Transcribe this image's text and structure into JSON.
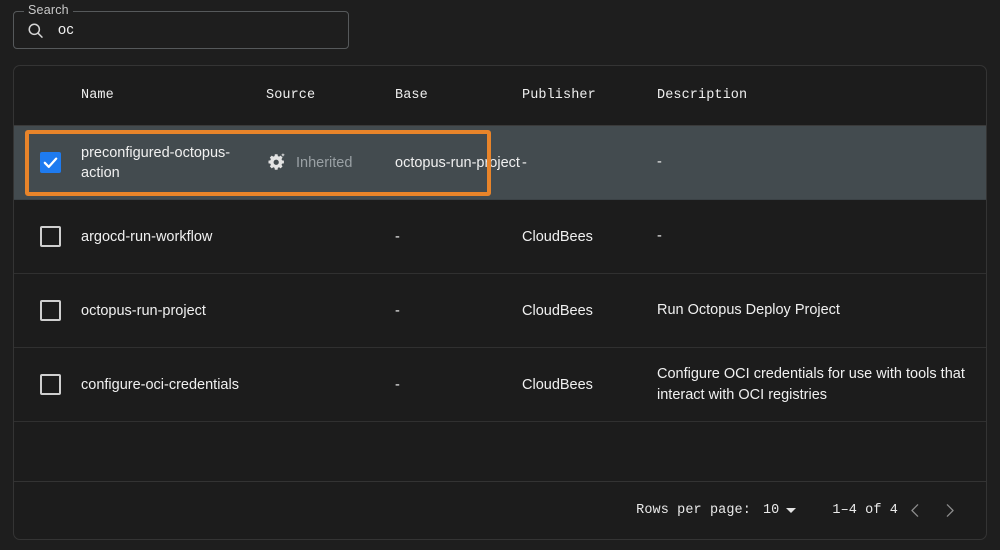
{
  "search": {
    "label": "Search",
    "value": "oc",
    "placeholder": "",
    "icon": "search-icon"
  },
  "table": {
    "columns": [
      {
        "key": "select",
        "label": ""
      },
      {
        "key": "name",
        "label": "Name"
      },
      {
        "key": "source",
        "label": "Source"
      },
      {
        "key": "base",
        "label": "Base"
      },
      {
        "key": "publisher",
        "label": "Publisher"
      },
      {
        "key": "description",
        "label": "Description"
      }
    ],
    "rows": [
      {
        "selected": true,
        "checked": true,
        "name": "preconfigured-octopus-action",
        "source": "Inherited",
        "source_icon": "gear-sparkle-icon",
        "base": "octopus-run-project",
        "publisher": "-",
        "description": "-"
      },
      {
        "selected": false,
        "checked": false,
        "name": "argocd-run-workflow",
        "source": "",
        "source_icon": "",
        "base": "-",
        "publisher": "CloudBees",
        "description": "-"
      },
      {
        "selected": false,
        "checked": false,
        "name": "octopus-run-project",
        "source": "",
        "source_icon": "",
        "base": "-",
        "publisher": "CloudBees",
        "description": "Run Octopus Deploy Project"
      },
      {
        "selected": false,
        "checked": false,
        "name": "configure-oci-credentials",
        "source": "",
        "source_icon": "",
        "base": "-",
        "publisher": "CloudBees",
        "description": "Configure OCI credentials for use with tools that interact with OCI registries"
      }
    ]
  },
  "footer": {
    "rows_per_page_label": "Rows per page:",
    "rows_per_page_value": "10",
    "range_label": "1–4 of 4",
    "prev_icon": "chevron-left-icon",
    "next_icon": "chevron-right-icon"
  },
  "colors": {
    "page_background": "#1e1e1e",
    "panel_background": "#1c1c1c",
    "selected_row_background": "#434b4f",
    "selection_outline": "#e8842a",
    "checkbox_checked": "#1e7bf0",
    "muted_text": "#9aa1a5"
  }
}
